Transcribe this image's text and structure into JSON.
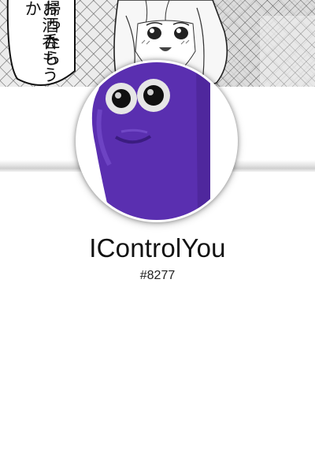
{
  "profile": {
    "username": "IControlYou",
    "discriminator": "#8277"
  },
  "banner": {
    "speech_lines": [
      "帰ったら",
      "お酒呑もうか"
    ],
    "style": "manga-grayscale"
  },
  "avatar": {
    "subject": "purple-blob-creature",
    "color": "#5a2fb0"
  },
  "colors": {
    "background": "#ffffff",
    "text": "#111111",
    "avatar_purple": "#5a2fb0"
  }
}
